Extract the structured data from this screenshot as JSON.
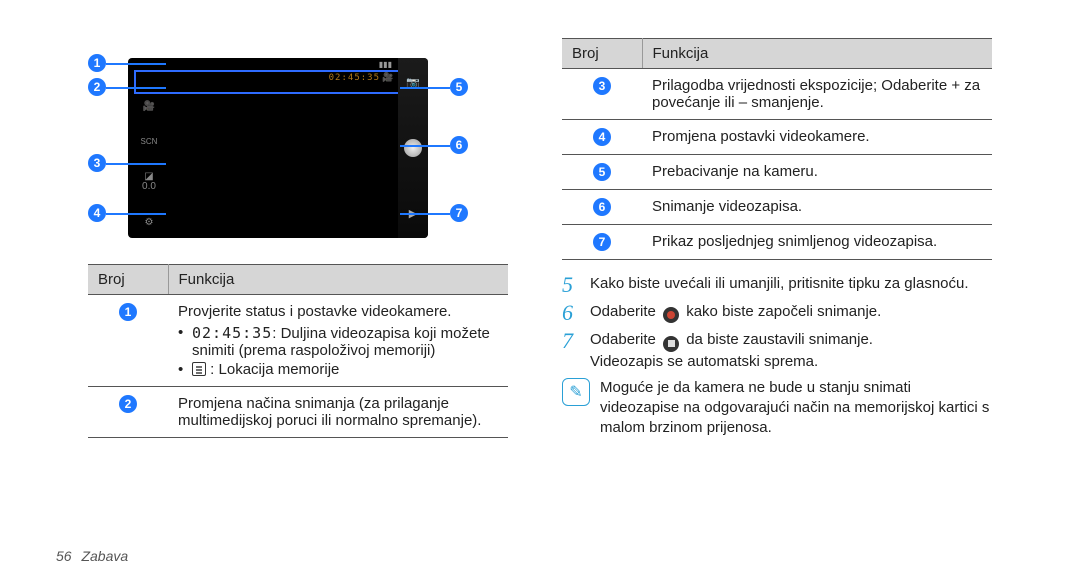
{
  "viewfinder": {
    "timecode": "02:45:35"
  },
  "left_table": {
    "header": {
      "num": "Broj",
      "func": "Funkcija"
    },
    "rows": [
      {
        "n": "1",
        "line1": "Provjerite status i postavke videokamere.",
        "b1_code": "02:45:35",
        "b1_rest": ": Duljina videozapisa koji možete snimiti (prema raspoloživoj memoriji)",
        "b2_rest": ": Lokacija memorije"
      },
      {
        "n": "2",
        "line1": "Promjena načina snimanja (za prilaganje multimedijskoj poruci ili normalno spremanje)."
      }
    ]
  },
  "right_table": {
    "header": {
      "num": "Broj",
      "func": "Funkcija"
    },
    "rows": [
      {
        "n": "3",
        "text": "Prilagodba vrijednosti ekspozicije; Odaberite + za povećanje ili – smanjenje."
      },
      {
        "n": "4",
        "text": "Promjena postavki videokamere."
      },
      {
        "n": "5",
        "text": "Prebacivanje na kameru."
      },
      {
        "n": "6",
        "text": "Snimanje videozapisa."
      },
      {
        "n": "7",
        "text": "Prikaz posljednjeg snimljenog videozapisa."
      }
    ]
  },
  "steps": {
    "s5": {
      "num": "5",
      "text": "Kako biste uvećali ili umanjili, pritisnite tipku za glasnoću."
    },
    "s6": {
      "num": "6",
      "pre": "Odaberite",
      "post": "kako biste započeli snimanje."
    },
    "s7": {
      "num": "7",
      "pre": "Odaberite",
      "post": "da biste zaustavili snimanje.",
      "extra": "Videozapis se automatski sprema."
    }
  },
  "note": {
    "text": "Moguće je da kamera ne bude u stanju snimati videozapise na odgovarajući način na memorijskoj kartici s malom brzinom prijenosa."
  },
  "footer": {
    "page": "56",
    "section": "Zabava"
  }
}
